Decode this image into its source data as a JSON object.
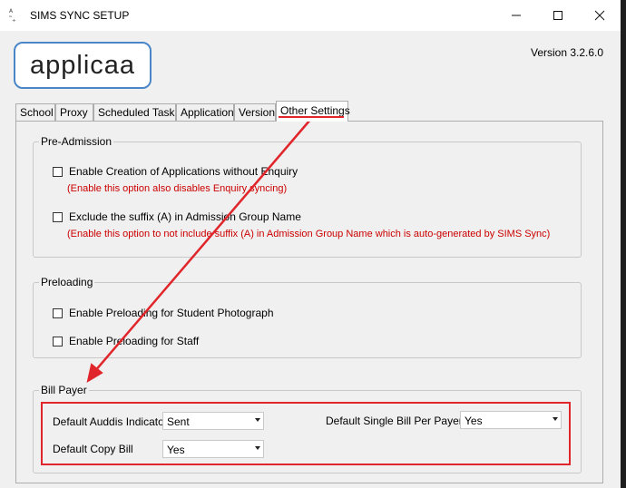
{
  "window": {
    "title": "SIMS SYNC SETUP"
  },
  "logo": {
    "text": "applicaa"
  },
  "version": "Version 3.2.6.0",
  "tabs": [
    {
      "label": "School"
    },
    {
      "label": "Proxy"
    },
    {
      "label": "Scheduled Task"
    },
    {
      "label": "Application"
    },
    {
      "label": "Version"
    },
    {
      "label": "Other Settings"
    }
  ],
  "pre_admission": {
    "title": "Pre-Admission",
    "option1": "Enable Creation of Applications without Enquiry",
    "note1": "(Enable this option also disables Enquiry syncing)",
    "option2": "Exclude the suffix (A) in Admission Group Name",
    "note2": "(Enable this option to not include suffix (A) in Admission Group Name which is auto-generated by SIMS Sync)"
  },
  "preloading": {
    "title": "Preloading",
    "option1": "Enable Preloading for Student Photograph",
    "option2": "Enable Preloading for Staff"
  },
  "bill_payer": {
    "title": "Bill Payer",
    "auddis_label": "Default Auddis Indicator",
    "auddis_value": "Sent",
    "copy_bill_label": "Default Copy Bill",
    "copy_bill_value": "Yes",
    "single_bill_label": "Default Single Bill Per Payer",
    "single_bill_value": "Yes"
  },
  "colors": {
    "annotation": "#e0262b",
    "note_text": "#cc0000",
    "logo_border": "#4a86c8"
  }
}
